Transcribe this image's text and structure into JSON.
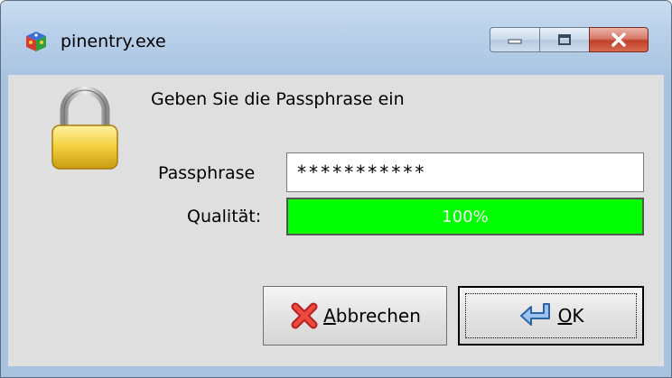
{
  "window": {
    "title": "pinentry.exe",
    "app_icon": "gpg-cube-icon",
    "controls": {
      "minimize": "minimize-icon",
      "maximize": "maximize-icon",
      "close": "close-icon"
    }
  },
  "dialog": {
    "heading": "Geben Sie die Passphrase ein",
    "icon": "padlock-icon",
    "passphrase_label": "Passphrase",
    "passphrase_value": "***********",
    "quality_label": "Qualität:",
    "quality_text": "100%",
    "quality_fraction": 1.0,
    "quality_color": "#00ff00"
  },
  "buttons": {
    "cancel": {
      "underlined": "A",
      "rest": "bbrechen",
      "icon": "red-x-icon"
    },
    "ok": {
      "underlined": "O",
      "rest": "K",
      "icon": "enter-arrow-icon"
    }
  }
}
